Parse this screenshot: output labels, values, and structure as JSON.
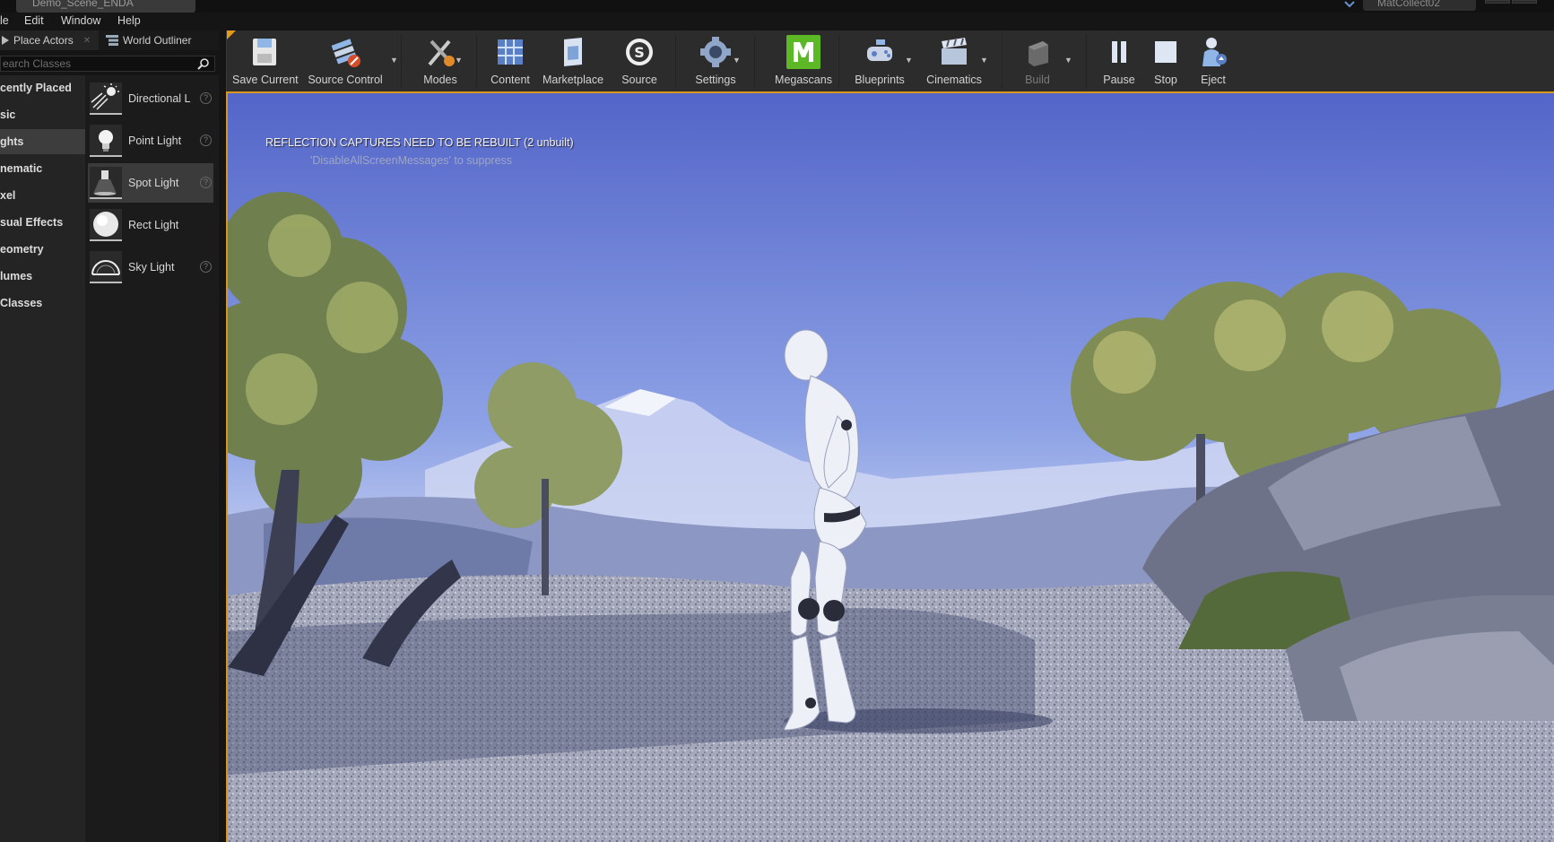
{
  "window": {
    "doc_tab": "Demo_Scene_ENDA",
    "right_tab": "MatCollect02"
  },
  "menu": [
    "le",
    "Edit",
    "Window",
    "Help"
  ],
  "panel_tabs": {
    "place_actors": "Place Actors",
    "world_outliner": "World Outliner"
  },
  "search": {
    "placeholder": "earch Classes"
  },
  "categories": [
    {
      "label": "cently Placed"
    },
    {
      "label": "sic"
    },
    {
      "label": "ghts"
    },
    {
      "label": "nematic"
    },
    {
      "label": "xel"
    },
    {
      "label": "sual Effects"
    },
    {
      "label": "eometry"
    },
    {
      "label": "lumes"
    },
    {
      "label": " Classes"
    }
  ],
  "active_category": "ghts",
  "actors": [
    {
      "label": "Directional L",
      "icon": "directional-light-icon"
    },
    {
      "label": "Point Light",
      "icon": "point-light-icon"
    },
    {
      "label": "Spot Light",
      "icon": "spot-light-icon"
    },
    {
      "label": "Rect Light",
      "icon": "rect-light-icon"
    },
    {
      "label": "Sky Light",
      "icon": "sky-light-icon"
    }
  ],
  "toolbar": {
    "save_current": "Save Current",
    "source_control": "Source Control",
    "modes": "Modes",
    "content": "Content",
    "marketplace": "Marketplace",
    "source": "Source",
    "settings": "Settings",
    "megascans": "Megascans",
    "blueprints": "Blueprints",
    "cinematics": "Cinematics",
    "build": "Build",
    "pause": "Pause",
    "stop": "Stop",
    "eject": "Eject"
  },
  "viewport": {
    "warning": "REFLECTION CAPTURES NEED TO BE REBUILT (2 unbuilt)",
    "suppress_hint": "'DisableAllScreenMessages' to suppress"
  },
  "colors": {
    "accent": "#e59b1a",
    "megascans": "#5cb825"
  }
}
